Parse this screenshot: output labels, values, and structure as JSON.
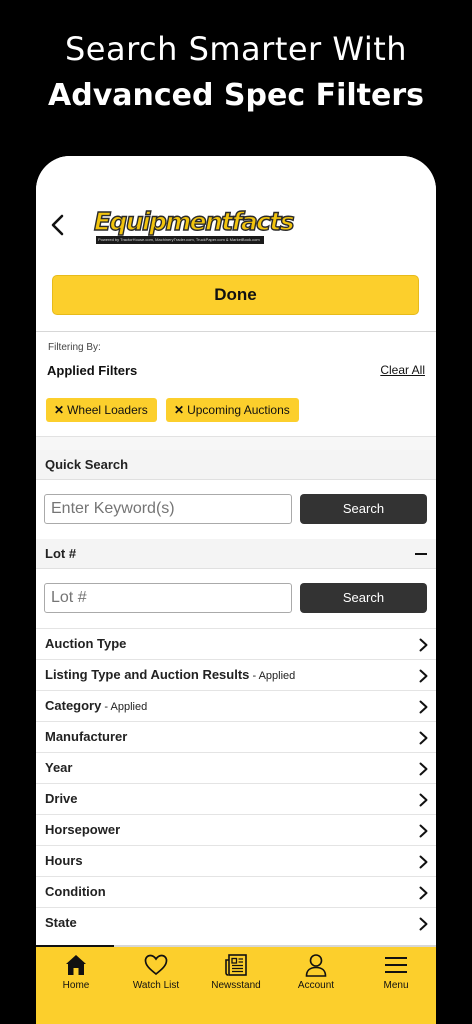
{
  "promo": {
    "line1": "Search Smarter With",
    "line2": "Advanced Spec Filters"
  },
  "header": {
    "logo_text": "Equipmentfacts",
    "logo_tagline": "Powered by TractorHouse.com, MachineryTrader.com, TruckPaper.com & MarketBook.com",
    "back_icon": "chevron-left-icon"
  },
  "done_label": "Done",
  "filters": {
    "filtering_by": "Filtering By:",
    "title": "Applied Filters",
    "clear_all": "Clear All",
    "chips": [
      {
        "x": "✕",
        "label": "Wheel Loaders"
      },
      {
        "x": "✕",
        "label": "Upcoming Auctions"
      }
    ]
  },
  "quick_search": {
    "title": "Quick Search",
    "placeholder": "Enter Keyword(s)",
    "button": "Search"
  },
  "lot": {
    "title": "Lot #",
    "placeholder": "Lot #",
    "button": "Search"
  },
  "rows": [
    {
      "label": "Auction Type",
      "applied": ""
    },
    {
      "label": "Listing Type and Auction Results",
      "applied": " - Applied"
    },
    {
      "label": "Category",
      "applied": " - Applied"
    },
    {
      "label": "Manufacturer",
      "applied": ""
    },
    {
      "label": "Year",
      "applied": ""
    },
    {
      "label": "Drive",
      "applied": ""
    },
    {
      "label": "Horsepower",
      "applied": ""
    },
    {
      "label": "Hours",
      "applied": ""
    },
    {
      "label": "Condition",
      "applied": ""
    },
    {
      "label": "State",
      "applied": ""
    }
  ],
  "tabs": [
    {
      "label": "Home",
      "icon": "home-icon"
    },
    {
      "label": "Watch List",
      "icon": "heart-icon"
    },
    {
      "label": "Newsstand",
      "icon": "newspaper-icon"
    },
    {
      "label": "Account",
      "icon": "user-icon"
    },
    {
      "label": "Menu",
      "icon": "menu-icon"
    }
  ],
  "colors": {
    "brand_yellow": "#fccf2c",
    "dark_button": "#333333"
  }
}
